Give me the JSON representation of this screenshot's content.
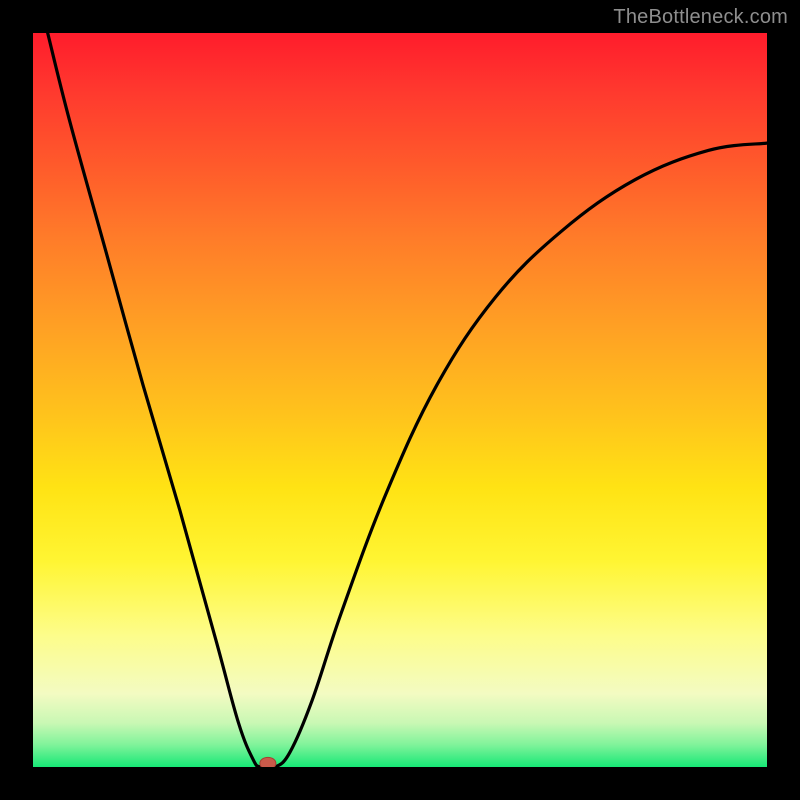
{
  "watermark": "TheBottleneck.com",
  "chart_data": {
    "type": "line",
    "title": "",
    "xlabel": "",
    "ylabel": "",
    "xlim": [
      0,
      100
    ],
    "ylim": [
      0,
      100
    ],
    "grid": false,
    "legend": false,
    "series": [
      {
        "name": "bottleneck-curve",
        "x": [
          2,
          5,
          10,
          15,
          20,
          25,
          28,
          30,
          31,
          33,
          35,
          38,
          42,
          48,
          55,
          63,
          72,
          82,
          92,
          100
        ],
        "y": [
          100,
          88,
          70,
          52,
          35,
          17,
          6,
          1,
          0,
          0,
          2,
          9,
          21,
          37,
          52,
          64,
          73,
          80,
          84,
          85
        ]
      }
    ],
    "marker": {
      "x": 32,
      "y": 0.5
    },
    "colors": {
      "curve": "#000000",
      "gradient_top": "#ff1c2c",
      "gradient_mid": "#ffe314",
      "gradient_bottom": "#17e876",
      "marker": "#c95a4a"
    }
  }
}
